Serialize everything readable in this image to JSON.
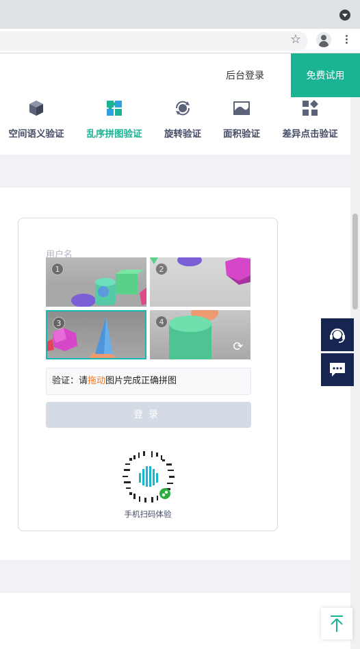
{
  "header": {
    "admin_login": "后台登录",
    "free_trial": "免费试用"
  },
  "nav": {
    "items": [
      {
        "label": "空间语义验证",
        "icon": "cube-icon",
        "active": false
      },
      {
        "label": "乱序拼图验证",
        "icon": "puzzle-icon",
        "active": true
      },
      {
        "label": "旋转验证",
        "icon": "rotate-icon",
        "active": false
      },
      {
        "label": "面积验证",
        "icon": "area-icon",
        "active": false
      },
      {
        "label": "差异点击验证",
        "icon": "grid-diff-icon",
        "active": false
      }
    ]
  },
  "card": {
    "username_label": "用户名",
    "tiles": [
      "1",
      "2",
      "3",
      "4"
    ],
    "verify_prefix": "验证：请",
    "verify_highlight": "拖动",
    "verify_suffix": "图片完成正确拼图",
    "login_label": "登录",
    "qr_caption": "手机扫码体验"
  },
  "colors": {
    "accent": "#1ab394",
    "navy": "#172650",
    "highlight": "#ef7a2b"
  },
  "floating": {
    "support_icon": "headset-icon",
    "chat_icon": "chat-icon",
    "top_icon": "arrow-up-icon"
  }
}
